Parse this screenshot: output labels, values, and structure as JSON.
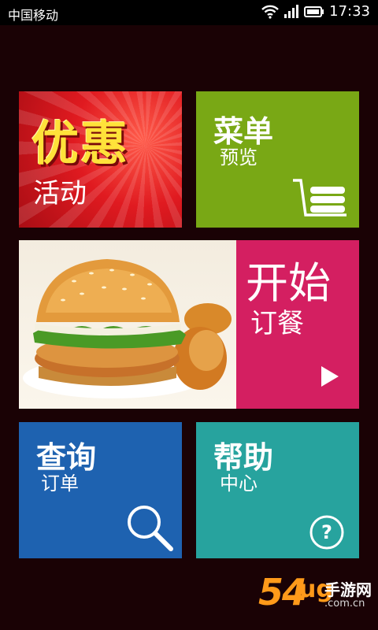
{
  "status_bar": {
    "carrier": "中国移动",
    "time": "17:33"
  },
  "tiles": {
    "promotions": {
      "title": "优惠",
      "subtitle": "活动",
      "color": "#e01a20"
    },
    "menu": {
      "title": "菜单",
      "subtitle": "预览",
      "color": "#79a815"
    },
    "order": {
      "title": "开始",
      "subtitle": "订餐",
      "color": "#d41f61"
    },
    "query": {
      "title": "查询",
      "subtitle": "订单",
      "color": "#1e62b0"
    },
    "help": {
      "title": "帮助",
      "subtitle": "中心",
      "color": "#27a39e"
    }
  },
  "icons": {
    "menu": "shopping-cart-icon",
    "order": "play-arrow-icon",
    "query": "magnifier-icon",
    "help": "question-circle-icon"
  },
  "watermark": {
    "number": "54",
    "brand_mark": "ug",
    "text": "手游网",
    "domain": ".com.cn"
  }
}
